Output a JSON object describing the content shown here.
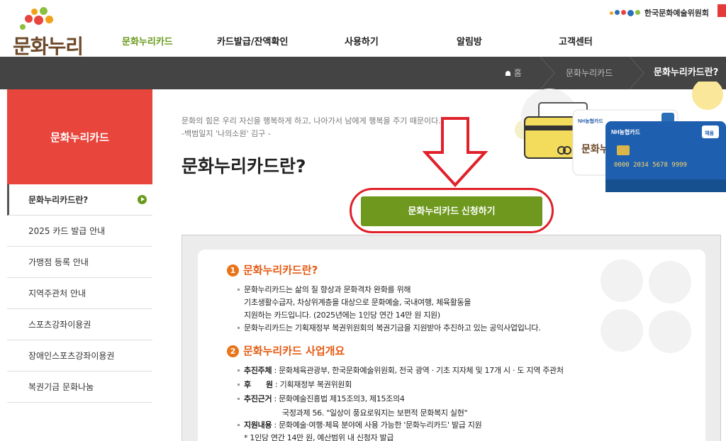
{
  "logo": {
    "text": "문화누리"
  },
  "gnb": {
    "items": [
      "문화누리카드",
      "카드발급/잔액확인",
      "사용하기",
      "알림방",
      "고객센터"
    ]
  },
  "org": {
    "name": "한국문화예술위원회"
  },
  "breadcrumb": {
    "home": "홈",
    "level1": "문화누리카드",
    "current": "문화누리카드란?"
  },
  "sidebar": {
    "title": "문화누리카드",
    "items": [
      "문화누리카드란?",
      "2025 카드 발급 안내",
      "가맹점 등록 안내",
      "지역주관처 안내",
      "스포츠강좌이용권",
      "장애인스포츠강좌이용권",
      "복권기금 문화나눔"
    ]
  },
  "content": {
    "quote_line1": "문화의 힘은 우리 자신을 행복하게 하고, 나아가서 남에게 행복을 주기 때문이다.",
    "quote_line2": "-백범일지 '나의소원' 김구 -",
    "title": "문화누리카드란?",
    "apply_button": "문화누리카드 신청하기"
  },
  "card_art": {
    "card_number": "0000 2034 5678 9999",
    "brand": "NH농협카드",
    "badge": "채움"
  },
  "section1": {
    "num": "1",
    "title": "문화누리카드란?",
    "lines": [
      "문화누리카드는 삶의 질 향상과 문화격차 완화를 위해",
      "기초생활수급자, 차상위계층을 대상으로 문화예술, 국내여행, 체육활동을",
      "지원하는 카드입니다. (2025년에는 1인당 연간 14만 원 지원)",
      "문화누리카드는 기획재정부 복권위원회의 복권기금을 지원받아 추진하고 있는 공익사업입니다."
    ]
  },
  "section2": {
    "num": "2",
    "title": "문화누리카드 사업개요",
    "rows": [
      {
        "label": "추진주체",
        "text": " : 문화체육관광부, 한국문화예술위원회, 전국 광역 · 기초 지자체 및 17개 시 · 도 지역 주관처"
      },
      {
        "label": "후      원",
        "text": " : 기획재정부 복권위원회"
      },
      {
        "label": "추진근거",
        "text": " : 문화예술진흥법 제15조의3, 제15조의4"
      },
      {
        "label": "",
        "text": "국정과제 56. \"일상이 풍요로워지는 보편적 문화복지 실현\""
      },
      {
        "label": "지원내용",
        "text": " : 문화예술·여행·체육 분야에 사용 가능한 '문화누리카드' 발급 지원"
      },
      {
        "label": "",
        "text": "* 1인당 연간 14만 원, 예산범위 내 신청자 발급"
      }
    ]
  },
  "colors": {
    "accent_green": "#6e981e",
    "sidebar_red": "#e8453c",
    "section_orange": "#e55a12",
    "breadcrumb_bg": "#444444",
    "highlight_red": "#e0202a"
  }
}
